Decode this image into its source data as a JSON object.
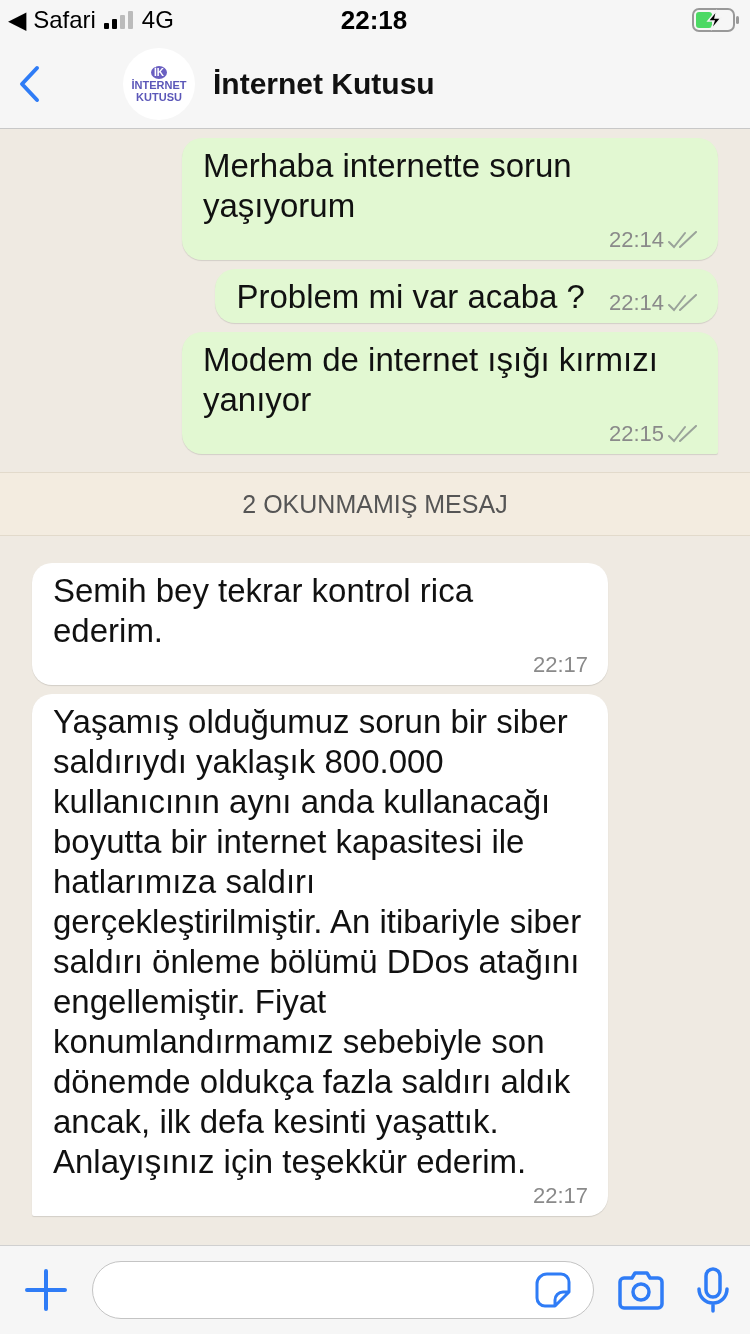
{
  "status_bar": {
    "back_app": "◀ Safari",
    "network": "4G",
    "time": "22:18"
  },
  "header": {
    "title": "İnternet Kutusu",
    "avatar": {
      "line_1": "İNTERNET",
      "line_2": "KUTUSU",
      "mark": "İK"
    }
  },
  "messages": [
    {
      "kind": "out",
      "text": "Merhaba internette sorun yaşıyorum",
      "time": "22:14",
      "read": false,
      "tail": false
    },
    {
      "kind": "out",
      "text": "Problem mi var acaba ?",
      "time": "22:14",
      "read": false,
      "tail": false
    },
    {
      "kind": "out",
      "text": "Modem de internet ışığı kırmızı yanıyor",
      "time": "22:15",
      "read": false,
      "tail": true
    },
    {
      "kind": "divider",
      "text": "2 OKUNMAMIŞ MESAJ"
    },
    {
      "kind": "in",
      "text": "Semih bey tekrar kontrol rica ederim.",
      "time": "22:17",
      "tail": false
    },
    {
      "kind": "in",
      "text": "Yaşamış olduğumuz sorun bir siber saldırıydı yaklaşık 800.000 kullanıcının aynı anda kullanacağı boyutta bir internet kapasitesi ile hatlarımıza saldırı gerçekleştirilmiştir. An itibariyle siber saldırı önleme bölümü DDos atağını engellemiştir. Fiyat konumlandırmamız sebebiyle son dönemde oldukça fazla saldırı aldık ancak, ilk defa kesinti yaşattık. Anlayışınız için teşekkür ederim.",
      "time": "22:17",
      "tail": true
    }
  ]
}
